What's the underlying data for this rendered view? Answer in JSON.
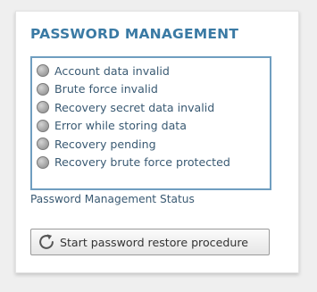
{
  "panel": {
    "title": "PASSWORD MANAGEMENT",
    "status_indicators": [
      {
        "label": "Account data invalid",
        "state": "off"
      },
      {
        "label": "Brute force invalid",
        "state": "off"
      },
      {
        "label": "Recovery secret data invalid",
        "state": "off"
      },
      {
        "label": "Error while storing data",
        "state": "off"
      },
      {
        "label": "Recovery pending",
        "state": "off"
      },
      {
        "label": "Recovery brute force protected",
        "state": "off"
      }
    ],
    "status_caption": "Password Management Status",
    "restore_button": {
      "label": "Start password restore procedure",
      "icon": "refresh-icon"
    }
  },
  "colors": {
    "title": "#3a7aa4",
    "box_border": "#6f9ec0",
    "text": "#3a5a73",
    "led_off": "#a9a9a9"
  }
}
